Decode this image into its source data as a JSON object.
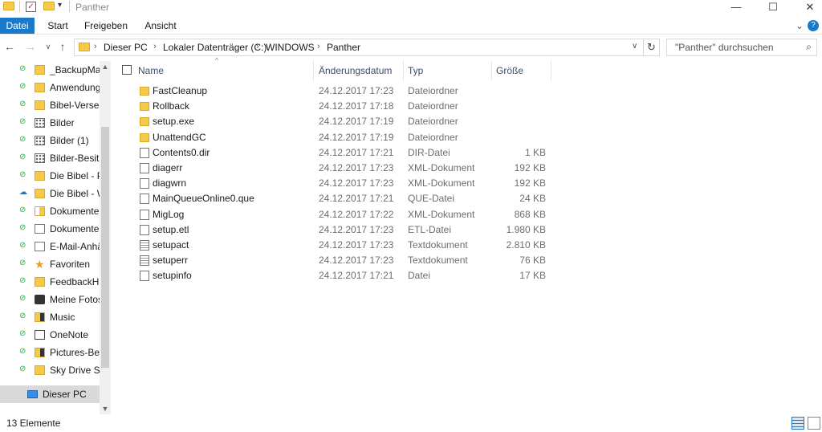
{
  "window": {
    "title": "Panther",
    "minimize": "—",
    "maximize": "☐",
    "close": "✕"
  },
  "ribbon": {
    "tabs": [
      "Datei",
      "Start",
      "Freigeben",
      "Ansicht"
    ],
    "expand_glyph": "⌄",
    "help_glyph": "?"
  },
  "address": {
    "crumbs": [
      "Dieser PC",
      "Lokaler Datenträger (C:)",
      "WINDOWS",
      "Panther"
    ],
    "search_placeholder": "\"Panther\" durchsuchen"
  },
  "nav": {
    "items": [
      {
        "label": "_BackupMan",
        "icon": "folder-icon",
        "status": "synced"
      },
      {
        "label": "Anwendung",
        "icon": "folder-icon",
        "status": "synced"
      },
      {
        "label": "Bibel-Verse",
        "icon": "folder-icon",
        "status": "synced"
      },
      {
        "label": "Bilder",
        "icon": "pictures-icon",
        "status": "synced"
      },
      {
        "label": "Bilder (1)",
        "icon": "pictures-icon",
        "status": "synced"
      },
      {
        "label": "Bilder-Besitz",
        "icon": "pictures-icon",
        "status": "synced"
      },
      {
        "label": "Die Bibel - Pl",
        "icon": "folder-icon",
        "status": "synced"
      },
      {
        "label": "Die Bibel - W",
        "icon": "folder-icon",
        "status": "cloud"
      },
      {
        "label": "Dokumente",
        "icon": "documents-icon",
        "status": "synced"
      },
      {
        "label": "Dokumente-",
        "icon": "document-icon",
        "status": "synced"
      },
      {
        "label": "E-Mail-Anhä",
        "icon": "mail-icon",
        "status": "synced"
      },
      {
        "label": "Favoriten",
        "icon": "star-icon",
        "status": "synced"
      },
      {
        "label": "FeedbackHu",
        "icon": "folder-icon",
        "status": "synced"
      },
      {
        "label": "Meine Fotos",
        "icon": "camera-icon",
        "status": "synced"
      },
      {
        "label": "Music",
        "icon": "music-icon",
        "status": "synced"
      },
      {
        "label": "OneNote",
        "icon": "onenote-icon",
        "status": "synced"
      },
      {
        "label": "Pictures-Bes",
        "icon": "pictures-folder-icon",
        "status": "synced"
      },
      {
        "label": "Sky Drive Set",
        "icon": "folder-icon",
        "status": "synced"
      }
    ],
    "this_pc": "Dieser PC"
  },
  "columns": {
    "name": "Name",
    "date": "Änderungsdatum",
    "type": "Typ",
    "size": "Größe"
  },
  "files": [
    {
      "name": "FastCleanup",
      "date": "24.12.2017 17:23",
      "type": "Dateiordner",
      "size": "",
      "kind": "folder"
    },
    {
      "name": "Rollback",
      "date": "24.12.2017 17:18",
      "type": "Dateiordner",
      "size": "",
      "kind": "folder"
    },
    {
      "name": "setup.exe",
      "date": "24.12.2017 17:19",
      "type": "Dateiordner",
      "size": "",
      "kind": "folder"
    },
    {
      "name": "UnattendGC",
      "date": "24.12.2017 17:19",
      "type": "Dateiordner",
      "size": "",
      "kind": "folder"
    },
    {
      "name": "Contents0.dir",
      "date": "24.12.2017 17:21",
      "type": "DIR-Datei",
      "size": "1 KB",
      "kind": "file"
    },
    {
      "name": "diagerr",
      "date": "24.12.2017 17:23",
      "type": "XML-Dokument",
      "size": "192 KB",
      "kind": "file"
    },
    {
      "name": "diagwrn",
      "date": "24.12.2017 17:23",
      "type": "XML-Dokument",
      "size": "192 KB",
      "kind": "file"
    },
    {
      "name": "MainQueueOnline0.que",
      "date": "24.12.2017 17:21",
      "type": "QUE-Datei",
      "size": "24 KB",
      "kind": "file"
    },
    {
      "name": "MigLog",
      "date": "24.12.2017 17:22",
      "type": "XML-Dokument",
      "size": "868 KB",
      "kind": "file"
    },
    {
      "name": "setup.etl",
      "date": "24.12.2017 17:23",
      "type": "ETL-Datei",
      "size": "1.980 KB",
      "kind": "file"
    },
    {
      "name": "setupact",
      "date": "24.12.2017 17:23",
      "type": "Textdokument",
      "size": "2.810 KB",
      "kind": "text"
    },
    {
      "name": "setuperr",
      "date": "24.12.2017 17:23",
      "type": "Textdokument",
      "size": "76 KB",
      "kind": "text"
    },
    {
      "name": "setupinfo",
      "date": "24.12.2017 17:21",
      "type": "Datei",
      "size": "17 KB",
      "kind": "file"
    }
  ],
  "status": {
    "count": "13 Elemente"
  }
}
